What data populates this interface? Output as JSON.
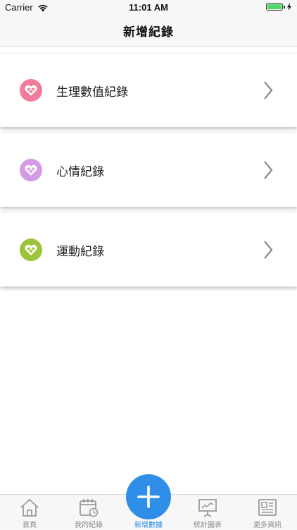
{
  "status_bar": {
    "carrier": "Carrier",
    "time": "11:01 AM",
    "battery_level": 1.0
  },
  "nav": {
    "title": "新增紀錄"
  },
  "records": [
    {
      "label": "生理數值紀錄",
      "icon": "heart-icon",
      "color": "#f07b9a"
    },
    {
      "label": "心情紀錄",
      "icon": "heart-icon",
      "color": "#d59be4"
    },
    {
      "label": "運動紀錄",
      "icon": "heart-icon",
      "color": "#9dc33a"
    }
  ],
  "tabs": [
    {
      "label": "首頁",
      "icon": "home-icon"
    },
    {
      "label": "我的紀錄",
      "icon": "calendar-icon"
    },
    {
      "label": "新增數據",
      "icon": "plus-icon",
      "active": true
    },
    {
      "label": "統計圖表",
      "icon": "presentation-chart-icon"
    },
    {
      "label": "更多資訊",
      "icon": "newspaper-icon"
    }
  ],
  "colors": {
    "accent": "#2f8fe8",
    "active_tab_text": "#1e88e5",
    "inactive_tab": "#8a8a8a"
  }
}
